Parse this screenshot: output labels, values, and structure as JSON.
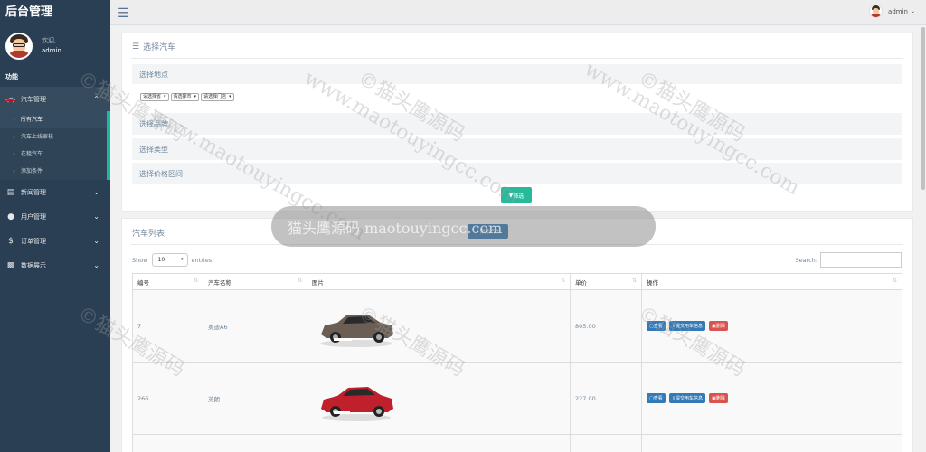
{
  "sidebar": {
    "brand": "后台管理",
    "welcome": "欢迎,",
    "username": "admin",
    "section": "功能",
    "menu": [
      {
        "label": "汽车管理",
        "icon": "car-icon"
      },
      {
        "label": "新闻管理",
        "icon": "newspaper-icon"
      },
      {
        "label": "用户管理",
        "icon": "user-icon"
      },
      {
        "label": "订单管理",
        "icon": "dollar-icon"
      },
      {
        "label": "数据展示",
        "icon": "bar-chart-icon"
      }
    ],
    "submenu": [
      "所有汽车",
      "汽车上线审核",
      "在租汽车",
      "添加条件"
    ]
  },
  "topbar": {
    "user": "admin"
  },
  "filter": {
    "title": "选择汽车",
    "location": "选择地点",
    "selects": [
      "请选择省",
      "请选择市",
      "请选择门店"
    ],
    "brand": "选择品牌",
    "type": "选择类型",
    "price": "选择价格区间",
    "filter_btn": "筛选"
  },
  "list": {
    "title": "汽车列表",
    "add_btn": "添加汽车",
    "show": "Show",
    "entries_value": "10",
    "entries": "entries",
    "search": "Search:",
    "columns": [
      "编号",
      "汽车名称",
      "图片",
      "单价",
      "操作"
    ],
    "rows": [
      {
        "id": "7",
        "name": "奥迪A6",
        "price": "805.00",
        "color": "#6b5f55"
      },
      {
        "id": "266",
        "name": "英朗",
        "price": "227.00",
        "color": "#c0202b"
      }
    ],
    "actions": {
      "view": "查看",
      "submit": "提交用车信息",
      "delete": "删除"
    }
  },
  "watermark": {
    "text": "©猫头鹰源码",
    "url": "www.maotouyingcc.com",
    "bar": "猫头鹰源码 maotouyingcc.com"
  }
}
